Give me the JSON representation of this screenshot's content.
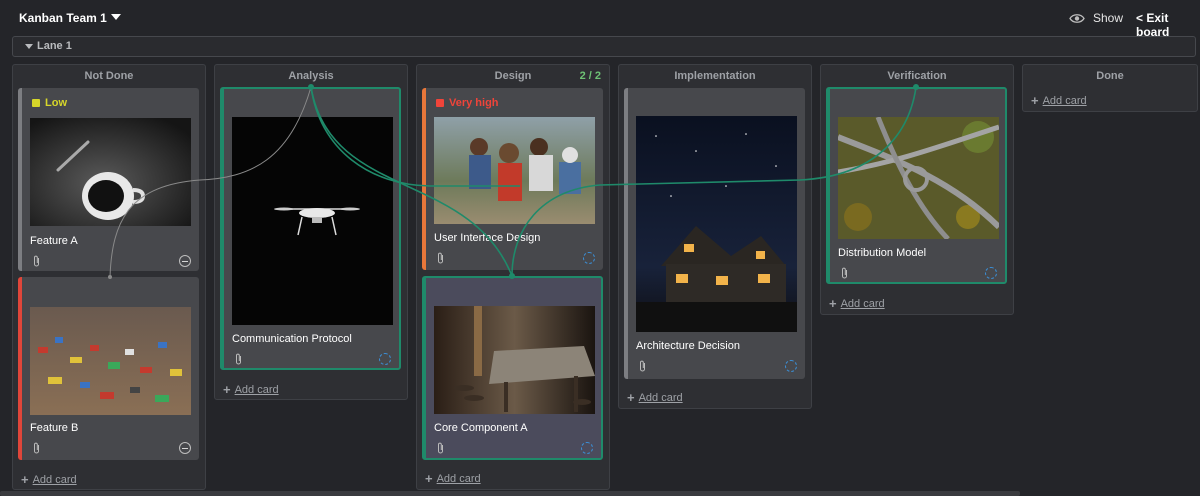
{
  "board": {
    "title": "Kanban Team 1"
  },
  "toolbar": {
    "show_label": "Show",
    "exit_label": "< Exit board"
  },
  "lane": {
    "label": "Lane 1"
  },
  "add_card_label": "Add card",
  "columns": [
    {
      "title": "Not Done"
    },
    {
      "title": "Analysis"
    },
    {
      "title": "Design",
      "wip": "2 / 2"
    },
    {
      "title": "Implementation"
    },
    {
      "title": "Verification"
    },
    {
      "title": "Done"
    }
  ],
  "cards": {
    "feature_a": {
      "title": "Feature A",
      "priority": "Low",
      "priority_color": "#d6d62a",
      "image": "coffee-cup-photo"
    },
    "feature_b": {
      "title": "Feature B",
      "image": "toy-blocks-photo",
      "accent": "#e0463a"
    },
    "communication_protocol": {
      "title": "Communication Protocol",
      "image": "drone-photo"
    },
    "user_interface_design": {
      "title": "User Interface Design",
      "priority": "Very high",
      "priority_color": "#f0443a",
      "image": "kids-playing-photo",
      "accent": "#e8773a"
    },
    "core_component_a": {
      "title": "Core Component A",
      "image": "wooden-table-photo"
    },
    "architecture_decision": {
      "title": "Architecture Decision",
      "image": "house-night-photo"
    },
    "distribution_model": {
      "title": "Distribution Model",
      "image": "highway-interchange-photo"
    }
  },
  "colors": {
    "link_line": "#1f8a6a",
    "selected_border": "#1f8a6a",
    "background": "#242529"
  }
}
